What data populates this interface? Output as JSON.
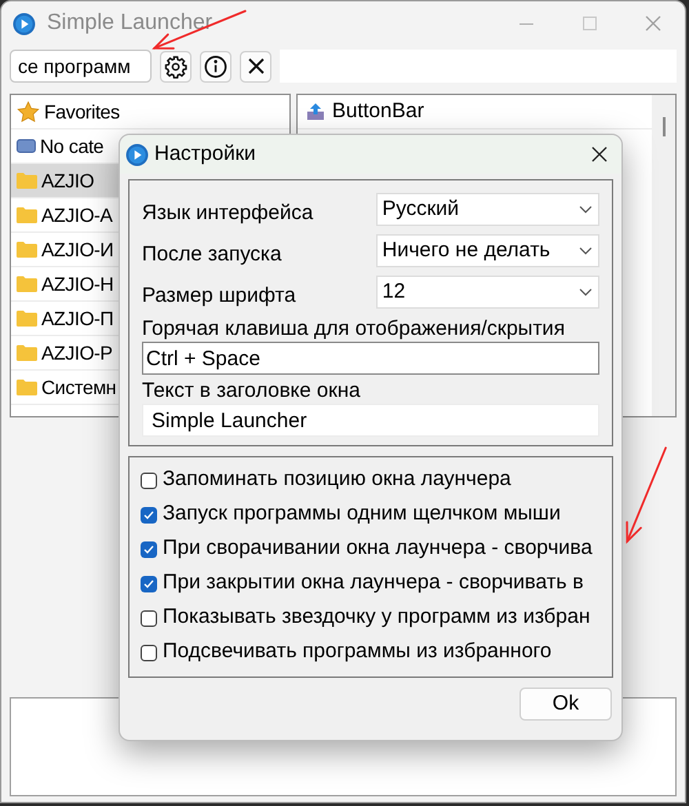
{
  "window": {
    "title": "Simple Launcher"
  },
  "toolbar": {
    "category_select": "се программ"
  },
  "categories": [
    {
      "label": "Favorites",
      "kind": "star",
      "selected": false
    },
    {
      "label": "No cate",
      "kind": "device",
      "selected": false
    },
    {
      "label": "AZJIO",
      "kind": "folder",
      "selected": true
    },
    {
      "label": "AZJIO-А",
      "kind": "folder",
      "selected": false
    },
    {
      "label": "AZJIO-И",
      "kind": "folder",
      "selected": false
    },
    {
      "label": "AZJIO-Н",
      "kind": "folder",
      "selected": false
    },
    {
      "label": "AZJIO-П",
      "kind": "folder",
      "selected": false
    },
    {
      "label": "AZJIO-Р",
      "kind": "folder",
      "selected": false
    },
    {
      "label": "Системн",
      "kind": "folder",
      "selected": false
    }
  ],
  "programs": [
    {
      "label": "ButtonBar"
    }
  ],
  "dialog": {
    "title": "Настройки",
    "selects": [
      {
        "label": "Язык интерфейса",
        "value": "Русский"
      },
      {
        "label": "После запуска",
        "value": "Ничего не делать"
      },
      {
        "label": "Размер шрифта",
        "value": "12"
      }
    ],
    "fields": [
      {
        "label": "Горячая клавиша для отображения/скрытия",
        "value": "Ctrl + Space"
      },
      {
        "label": "Текст в заголовке окна",
        "value": "Simple Launcher"
      }
    ],
    "checkboxes": [
      {
        "label": "Запоминать позицию окна лаунчера",
        "checked": false
      },
      {
        "label": "Запуск программы одним щелчком мыши",
        "checked": true
      },
      {
        "label": "При сворачивании окна лаунчера - сворчива",
        "checked": true
      },
      {
        "label": "При закрытии окна лаунчера - сворчивать в",
        "checked": true
      },
      {
        "label": "Показывать звездочку у программ из избран",
        "checked": false
      },
      {
        "label": "Подсвечивать программы из избранного",
        "checked": false
      }
    ],
    "ok_button": "Ok"
  }
}
